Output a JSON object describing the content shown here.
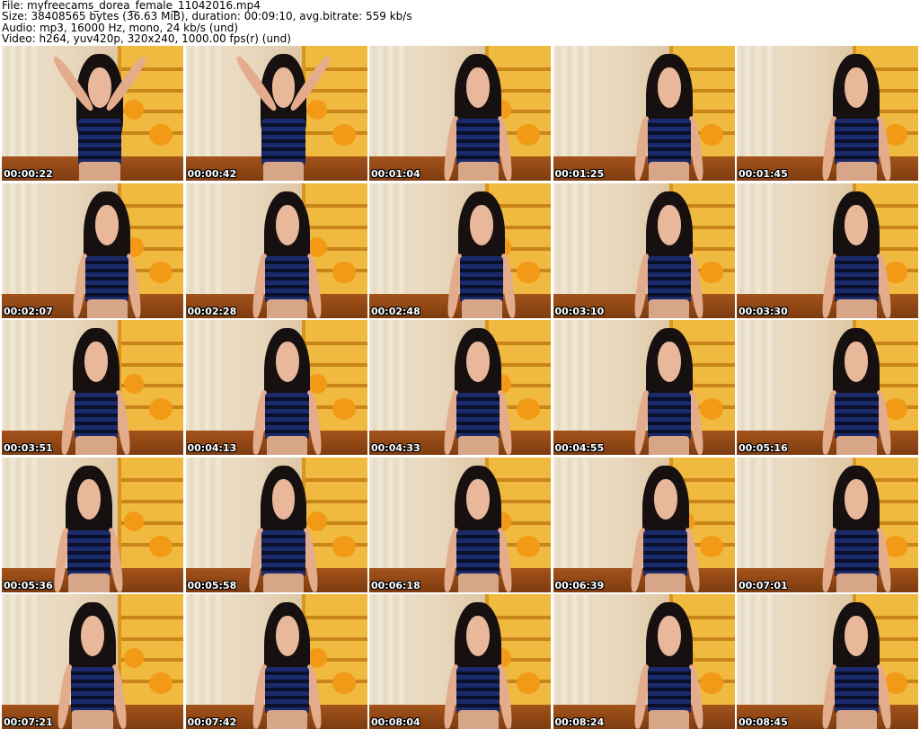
{
  "header": {
    "file_line": "File: myfreecams_dorea_female_11042016.mp4",
    "size_line": "Size: 38408565 bytes (36.63 MiB), duration: 00:09:10, avg.bitrate: 559 kb/s",
    "audio_line": "Audio: mp3, 16000 Hz, mono, 24 kb/s (und)",
    "video_line": "Video: h264, yuv420p, 320x240, 1000.00 fps(r) (und)"
  },
  "thumbnails": [
    {
      "timestamp": "00:00:22",
      "pose": "arms-up"
    },
    {
      "timestamp": "00:00:42",
      "pose": "arms-up"
    },
    {
      "timestamp": "00:01:04",
      "pose": "seated"
    },
    {
      "timestamp": "00:01:25",
      "pose": "seated"
    },
    {
      "timestamp": "00:01:45",
      "pose": "seated"
    },
    {
      "timestamp": "00:02:07",
      "pose": "seated"
    },
    {
      "timestamp": "00:02:28",
      "pose": "seated"
    },
    {
      "timestamp": "00:02:48",
      "pose": "seated"
    },
    {
      "timestamp": "00:03:10",
      "pose": "seated"
    },
    {
      "timestamp": "00:03:30",
      "pose": "seated"
    },
    {
      "timestamp": "00:03:51",
      "pose": "seated"
    },
    {
      "timestamp": "00:04:13",
      "pose": "seated"
    },
    {
      "timestamp": "00:04:33",
      "pose": "seated"
    },
    {
      "timestamp": "00:04:55",
      "pose": "seated"
    },
    {
      "timestamp": "00:05:16",
      "pose": "seated"
    },
    {
      "timestamp": "00:05:36",
      "pose": "seated"
    },
    {
      "timestamp": "00:05:58",
      "pose": "seated"
    },
    {
      "timestamp": "00:06:18",
      "pose": "seated"
    },
    {
      "timestamp": "00:06:39",
      "pose": "seated"
    },
    {
      "timestamp": "00:07:01",
      "pose": "seated"
    },
    {
      "timestamp": "00:07:21",
      "pose": "seated"
    },
    {
      "timestamp": "00:07:42",
      "pose": "seated"
    },
    {
      "timestamp": "00:08:04",
      "pose": "seated"
    },
    {
      "timestamp": "00:08:24",
      "pose": "seated"
    },
    {
      "timestamp": "00:08:45",
      "pose": "seated"
    }
  ],
  "colors": {
    "background": "#ffffff",
    "header_text": "#000000",
    "timestamp_text": "#ffffff",
    "timestamp_outline": "#000000"
  }
}
